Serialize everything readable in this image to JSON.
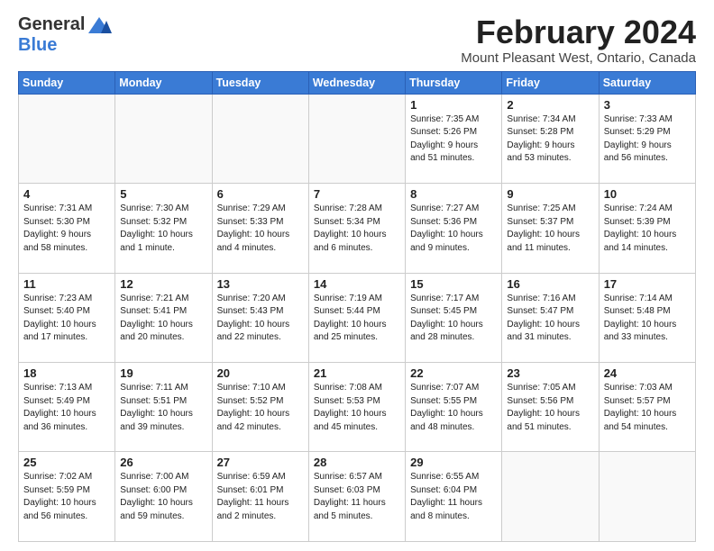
{
  "logo": {
    "general": "General",
    "blue": "Blue"
  },
  "title": "February 2024",
  "location": "Mount Pleasant West, Ontario, Canada",
  "days_header": [
    "Sunday",
    "Monday",
    "Tuesday",
    "Wednesday",
    "Thursday",
    "Friday",
    "Saturday"
  ],
  "weeks": [
    [
      {
        "num": "",
        "info": "",
        "empty": true
      },
      {
        "num": "",
        "info": "",
        "empty": true
      },
      {
        "num": "",
        "info": "",
        "empty": true
      },
      {
        "num": "",
        "info": "",
        "empty": true
      },
      {
        "num": "1",
        "info": "Sunrise: 7:35 AM\nSunset: 5:26 PM\nDaylight: 9 hours\nand 51 minutes.",
        "empty": false
      },
      {
        "num": "2",
        "info": "Sunrise: 7:34 AM\nSunset: 5:28 PM\nDaylight: 9 hours\nand 53 minutes.",
        "empty": false
      },
      {
        "num": "3",
        "info": "Sunrise: 7:33 AM\nSunset: 5:29 PM\nDaylight: 9 hours\nand 56 minutes.",
        "empty": false
      }
    ],
    [
      {
        "num": "4",
        "info": "Sunrise: 7:31 AM\nSunset: 5:30 PM\nDaylight: 9 hours\nand 58 minutes.",
        "empty": false
      },
      {
        "num": "5",
        "info": "Sunrise: 7:30 AM\nSunset: 5:32 PM\nDaylight: 10 hours\nand 1 minute.",
        "empty": false
      },
      {
        "num": "6",
        "info": "Sunrise: 7:29 AM\nSunset: 5:33 PM\nDaylight: 10 hours\nand 4 minutes.",
        "empty": false
      },
      {
        "num": "7",
        "info": "Sunrise: 7:28 AM\nSunset: 5:34 PM\nDaylight: 10 hours\nand 6 minutes.",
        "empty": false
      },
      {
        "num": "8",
        "info": "Sunrise: 7:27 AM\nSunset: 5:36 PM\nDaylight: 10 hours\nand 9 minutes.",
        "empty": false
      },
      {
        "num": "9",
        "info": "Sunrise: 7:25 AM\nSunset: 5:37 PM\nDaylight: 10 hours\nand 11 minutes.",
        "empty": false
      },
      {
        "num": "10",
        "info": "Sunrise: 7:24 AM\nSunset: 5:39 PM\nDaylight: 10 hours\nand 14 minutes.",
        "empty": false
      }
    ],
    [
      {
        "num": "11",
        "info": "Sunrise: 7:23 AM\nSunset: 5:40 PM\nDaylight: 10 hours\nand 17 minutes.",
        "empty": false
      },
      {
        "num": "12",
        "info": "Sunrise: 7:21 AM\nSunset: 5:41 PM\nDaylight: 10 hours\nand 20 minutes.",
        "empty": false
      },
      {
        "num": "13",
        "info": "Sunrise: 7:20 AM\nSunset: 5:43 PM\nDaylight: 10 hours\nand 22 minutes.",
        "empty": false
      },
      {
        "num": "14",
        "info": "Sunrise: 7:19 AM\nSunset: 5:44 PM\nDaylight: 10 hours\nand 25 minutes.",
        "empty": false
      },
      {
        "num": "15",
        "info": "Sunrise: 7:17 AM\nSunset: 5:45 PM\nDaylight: 10 hours\nand 28 minutes.",
        "empty": false
      },
      {
        "num": "16",
        "info": "Sunrise: 7:16 AM\nSunset: 5:47 PM\nDaylight: 10 hours\nand 31 minutes.",
        "empty": false
      },
      {
        "num": "17",
        "info": "Sunrise: 7:14 AM\nSunset: 5:48 PM\nDaylight: 10 hours\nand 33 minutes.",
        "empty": false
      }
    ],
    [
      {
        "num": "18",
        "info": "Sunrise: 7:13 AM\nSunset: 5:49 PM\nDaylight: 10 hours\nand 36 minutes.",
        "empty": false
      },
      {
        "num": "19",
        "info": "Sunrise: 7:11 AM\nSunset: 5:51 PM\nDaylight: 10 hours\nand 39 minutes.",
        "empty": false
      },
      {
        "num": "20",
        "info": "Sunrise: 7:10 AM\nSunset: 5:52 PM\nDaylight: 10 hours\nand 42 minutes.",
        "empty": false
      },
      {
        "num": "21",
        "info": "Sunrise: 7:08 AM\nSunset: 5:53 PM\nDaylight: 10 hours\nand 45 minutes.",
        "empty": false
      },
      {
        "num": "22",
        "info": "Sunrise: 7:07 AM\nSunset: 5:55 PM\nDaylight: 10 hours\nand 48 minutes.",
        "empty": false
      },
      {
        "num": "23",
        "info": "Sunrise: 7:05 AM\nSunset: 5:56 PM\nDaylight: 10 hours\nand 51 minutes.",
        "empty": false
      },
      {
        "num": "24",
        "info": "Sunrise: 7:03 AM\nSunset: 5:57 PM\nDaylight: 10 hours\nand 54 minutes.",
        "empty": false
      }
    ],
    [
      {
        "num": "25",
        "info": "Sunrise: 7:02 AM\nSunset: 5:59 PM\nDaylight: 10 hours\nand 56 minutes.",
        "empty": false
      },
      {
        "num": "26",
        "info": "Sunrise: 7:00 AM\nSunset: 6:00 PM\nDaylight: 10 hours\nand 59 minutes.",
        "empty": false
      },
      {
        "num": "27",
        "info": "Sunrise: 6:59 AM\nSunset: 6:01 PM\nDaylight: 11 hours\nand 2 minutes.",
        "empty": false
      },
      {
        "num": "28",
        "info": "Sunrise: 6:57 AM\nSunset: 6:03 PM\nDaylight: 11 hours\nand 5 minutes.",
        "empty": false
      },
      {
        "num": "29",
        "info": "Sunrise: 6:55 AM\nSunset: 6:04 PM\nDaylight: 11 hours\nand 8 minutes.",
        "empty": false
      },
      {
        "num": "",
        "info": "",
        "empty": true
      },
      {
        "num": "",
        "info": "",
        "empty": true
      }
    ]
  ]
}
